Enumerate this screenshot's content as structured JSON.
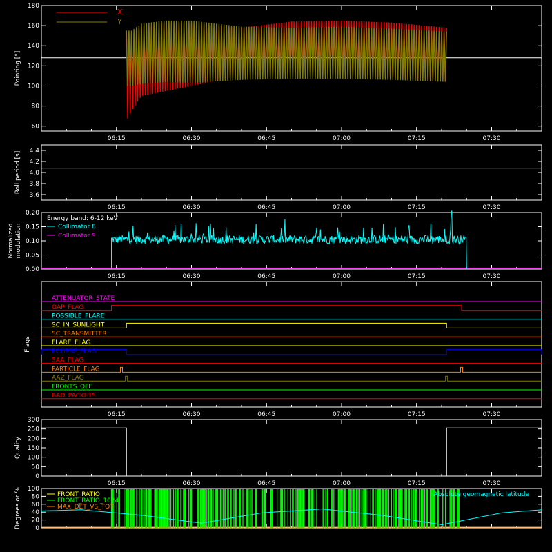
{
  "colors": {
    "background": "#000000",
    "axes": "#ffffff",
    "red": "#ff0000",
    "olive": "#808000",
    "cyan": "#00ffff",
    "magenta": "#ff00ff",
    "blue": "#0000ff",
    "yellow": "#ffff00",
    "orange": "#ff8000",
    "green": "#00ff00",
    "lime": "#00ff00"
  },
  "chart_data": [
    {
      "type": "line",
      "ylabel": "Pointing [°]",
      "xlim": [
        "06:00",
        "07:40"
      ],
      "x_ticks": [
        "06:15",
        "06:30",
        "06:45",
        "07:00",
        "07:15",
        "07:30"
      ],
      "ylim": [
        55,
        180
      ],
      "y_ticks": [
        "60",
        "80",
        "100",
        "120",
        "140",
        "160",
        "180"
      ],
      "legend": "top-left",
      "reference_level": 128,
      "series": [
        {
          "name": "X",
          "color": "red",
          "x": [
            "06:17",
            "06:18",
            "06:20",
            "06:25",
            "06:30",
            "06:40",
            "06:50",
            "07:00",
            "07:10",
            "07:21"
          ],
          "upper": [
            155,
            152,
            158,
            163,
            162,
            158,
            164,
            165,
            163,
            158
          ],
          "lower": [
            65,
            75,
            90,
            95,
            100,
            110,
            113,
            112,
            108,
            104
          ]
        },
        {
          "name": "Y",
          "color": "olive",
          "x": [
            "06:17",
            "06:18",
            "06:20",
            "06:25",
            "06:30",
            "06:40",
            "06:50",
            "07:00",
            "07:10",
            "07:21"
          ],
          "upper": [
            155,
            155,
            162,
            165,
            165,
            159,
            158,
            159,
            157,
            154
          ],
          "lower": [
            100,
            100,
            102,
            104,
            103,
            106,
            107,
            107,
            106,
            104
          ]
        }
      ]
    },
    {
      "type": "line",
      "ylabel": "Roll period [s]",
      "xlim": [
        "06:00",
        "07:40"
      ],
      "x_ticks": [
        "06:15",
        "06:30",
        "06:45",
        "07:00",
        "07:15",
        "07:30"
      ],
      "ylim": [
        3.5,
        4.5
      ],
      "y_ticks": [
        "3.6",
        "3.8",
        "4.0",
        "4.2",
        "4.4"
      ],
      "series": [
        {
          "x": [
            "06:00",
            "07:40"
          ],
          "values": [
            4.08,
            4.08
          ],
          "color": "axes"
        }
      ]
    },
    {
      "type": "line",
      "ylabel": "Normalized modulation",
      "xlim": [
        "06:00",
        "07:40"
      ],
      "x_ticks": [
        "06:15",
        "06:30",
        "06:45",
        "07:00",
        "07:15",
        "07:30"
      ],
      "ylim": [
        0,
        0.2
      ],
      "y_ticks": [
        "0.00",
        "0.05",
        "0.10",
        "0.15",
        "0.20"
      ],
      "legend": "top-left",
      "legend_title": "Energy band: 6-12 keV",
      "series": [
        {
          "name": "Collimator 8",
          "color": "cyan",
          "x_range": [
            "06:14",
            "07:25"
          ],
          "typical": 0.105,
          "spread": 0.03,
          "peak": 0.205
        },
        {
          "name": "Collimator 9",
          "color": "magenta",
          "x": [
            "06:00",
            "07:40"
          ],
          "values": [
            0,
            0
          ]
        }
      ]
    },
    {
      "type": "line",
      "ylabel": "Flags",
      "xlim": [
        "06:00",
        "07:40"
      ],
      "x_ticks": [
        "06:15",
        "06:30",
        "06:45",
        "07:00",
        "07:15",
        "07:30"
      ],
      "flags": [
        {
          "name": "ATTENUATOR_STATE",
          "color": "magenta",
          "segments": []
        },
        {
          "name": "GAP_FLAG",
          "color": "red",
          "segments": [
            {
              "start": "06:14",
              "end": "07:24",
              "level": 1
            }
          ]
        },
        {
          "name": "POSSIBLE_FLARE",
          "color": "cyan",
          "segments": []
        },
        {
          "name": "SC_IN_SUNLIGHT",
          "color": "yellow",
          "segments": [
            {
              "start": "06:17",
              "end": "07:21",
              "level": 1
            }
          ]
        },
        {
          "name": "SC_TRANSMITTER",
          "color": "orange",
          "segments": []
        },
        {
          "name": "FLARE_FLAG",
          "color": "yellow",
          "segments": []
        },
        {
          "name": "ECLIPSE_FLAG",
          "color": "blue",
          "segments": [
            {
              "start": "06:00",
              "end": "06:17",
              "level": 1
            },
            {
              "start": "07:21",
              "end": "07:40",
              "level": 1
            }
          ]
        },
        {
          "name": "SAA_FLAG",
          "color": "red",
          "segments": []
        },
        {
          "name": "PARTICLE_FLAG",
          "color": "orange",
          "spikes": [
            "06:16",
            "07:24"
          ]
        },
        {
          "name": "AAZ_FLAG",
          "color": "olive",
          "spikes": [
            "06:17",
            "07:21"
          ]
        },
        {
          "name": "FRONTS_OFF",
          "color": "green",
          "segments": []
        },
        {
          "name": "BAD_PACKETS",
          "color": "red",
          "segments": []
        }
      ]
    },
    {
      "type": "line",
      "ylabel": "Quality",
      "xlim": [
        "06:00",
        "07:40"
      ],
      "x_ticks": [
        "06:15",
        "06:30",
        "06:45",
        "07:00",
        "07:15",
        "07:30"
      ],
      "ylim": [
        0,
        300
      ],
      "y_ticks": [
        "0",
        "50",
        "100",
        "150",
        "200",
        "250",
        "300"
      ],
      "series": [
        {
          "color": "axes",
          "x": [
            "06:00",
            "06:17",
            "06:17",
            "07:21",
            "07:21",
            "07:40"
          ],
          "values": [
            255,
            255,
            0,
            0,
            255,
            255
          ]
        }
      ]
    },
    {
      "type": "line",
      "ylabel": "Degrees or %",
      "xlim": [
        "06:00",
        "07:40"
      ],
      "ylim": [
        0,
        100
      ],
      "y_ticks": [
        "0",
        "20",
        "40",
        "60",
        "80",
        "100"
      ],
      "legend": "top-left",
      "series": [
        {
          "name": "FRONT_RATIO",
          "color": "yellow"
        },
        {
          "name": "FRONT_RATIO_1024",
          "color": "lime",
          "x_range": [
            "06:14",
            "07:24"
          ]
        },
        {
          "name": "MAX_DET_VS_TOT",
          "color": "orange"
        },
        {
          "name": "Absolute geomagnetic latitude",
          "color": "cyan",
          "x": [
            "06:00",
            "06:08",
            "06:20",
            "06:32",
            "06:44",
            "06:56",
            "07:08",
            "07:20",
            "07:32",
            "07:40"
          ],
          "values": [
            43,
            46,
            32,
            12,
            38,
            48,
            32,
            8,
            38,
            46
          ]
        }
      ]
    }
  ]
}
